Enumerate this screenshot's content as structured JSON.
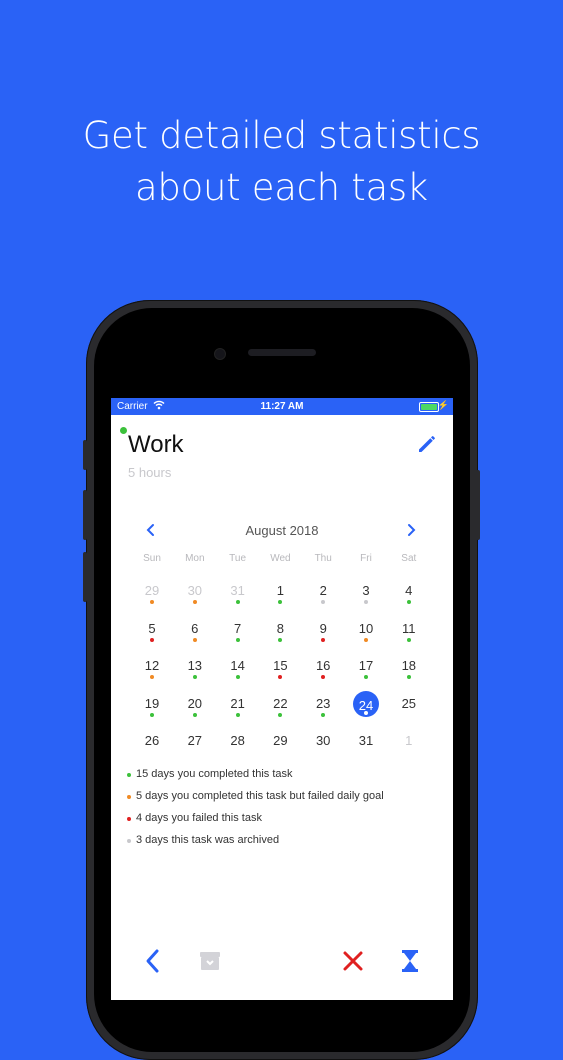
{
  "promo": {
    "line1": "Get detailed statistics",
    "line2": "about each task"
  },
  "status_bar": {
    "carrier": "Carrier",
    "time": "11:27 AM"
  },
  "task": {
    "title": "Work",
    "subtitle": "5 hours",
    "status_color": "#3cc13b"
  },
  "calendar": {
    "month_label": "August 2018",
    "weekdays": [
      "Sun",
      "Mon",
      "Tue",
      "Wed",
      "Thu",
      "Fri",
      "Sat"
    ],
    "weeks": [
      [
        {
          "d": "29",
          "faded": true,
          "mark": "orange"
        },
        {
          "d": "30",
          "faded": true,
          "mark": "orange"
        },
        {
          "d": "31",
          "faded": true,
          "mark": "green"
        },
        {
          "d": "1",
          "mark": "green"
        },
        {
          "d": "2",
          "mark": "gray"
        },
        {
          "d": "3",
          "mark": "gray"
        },
        {
          "d": "4",
          "mark": "green"
        }
      ],
      [
        {
          "d": "5",
          "mark": "red"
        },
        {
          "d": "6",
          "mark": "orange"
        },
        {
          "d": "7",
          "mark": "green"
        },
        {
          "d": "8",
          "mark": "green"
        },
        {
          "d": "9",
          "mark": "red"
        },
        {
          "d": "10",
          "mark": "orange"
        },
        {
          "d": "11",
          "mark": "green"
        }
      ],
      [
        {
          "d": "12",
          "mark": "orange"
        },
        {
          "d": "13",
          "mark": "green"
        },
        {
          "d": "14",
          "mark": "green"
        },
        {
          "d": "15",
          "mark": "red"
        },
        {
          "d": "16",
          "mark": "red"
        },
        {
          "d": "17",
          "mark": "green"
        },
        {
          "d": "18",
          "mark": "green"
        }
      ],
      [
        {
          "d": "19",
          "mark": "green"
        },
        {
          "d": "20",
          "mark": "green"
        },
        {
          "d": "21",
          "mark": "green"
        },
        {
          "d": "22",
          "mark": "green"
        },
        {
          "d": "23",
          "mark": "green"
        },
        {
          "d": "24",
          "today": true,
          "mark": "white"
        },
        {
          "d": "25"
        }
      ],
      [
        {
          "d": "26"
        },
        {
          "d": "27"
        },
        {
          "d": "28"
        },
        {
          "d": "29"
        },
        {
          "d": "30"
        },
        {
          "d": "31"
        },
        {
          "d": "1",
          "faded": true
        }
      ]
    ]
  },
  "legend": [
    {
      "color": "green",
      "text": "15 days you completed this task"
    },
    {
      "color": "orange",
      "text": "5 days you completed this task but failed daily goal"
    },
    {
      "color": "red",
      "text": "4 days you failed this task"
    },
    {
      "color": "gray",
      "text": "3 days this task was archived"
    }
  ],
  "colors": {
    "accent": "#2a62f6",
    "green": "#3cc13b",
    "orange": "#f08a24",
    "red": "#e02020",
    "gray": "#c8c8cc",
    "white": "#ffffff"
  },
  "toolbar_icons": [
    "chevron-left-icon",
    "archive-icon",
    "close-icon",
    "hourglass-icon"
  ]
}
